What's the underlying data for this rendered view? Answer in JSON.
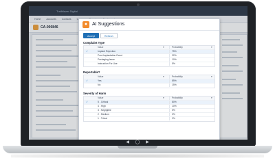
{
  "app": {
    "logo": "Trailblazer Digital",
    "nav": [
      "Home",
      "Accounts",
      "Contacts",
      "Cases",
      "Reports",
      "Dashboards"
    ],
    "record_title": "CA-000846"
  },
  "modal": {
    "title": "AI Suggestions",
    "accept_label": "Accept",
    "refresh_label": "Refresh",
    "column_value": "Value",
    "column_probability": "Probability",
    "sections": [
      {
        "title": "Complaint Type",
        "rows": [
          {
            "value": "Implant Rejection",
            "probability": "75%",
            "selected": true
          },
          {
            "value": "Post-Implantation Event",
            "probability": "22%",
            "selected": false
          },
          {
            "value": "Packaging Issue",
            "probability": "10%",
            "selected": false
          },
          {
            "value": "Instruction For Use",
            "probability": "5%",
            "selected": false
          }
        ]
      },
      {
        "title": "Reportable?",
        "rows": [
          {
            "value": "Yes",
            "probability": "85%",
            "selected": true
          },
          {
            "value": "No",
            "probability": "15%",
            "selected": false
          }
        ]
      },
      {
        "title": "Severity of Harm",
        "rows": [
          {
            "value": "5 - Critical",
            "probability": "80%",
            "selected": true
          },
          {
            "value": "4 - High",
            "probability": "10%",
            "selected": false
          },
          {
            "value": "3 - Negligible",
            "probability": "5%",
            "selected": false
          },
          {
            "value": "2 - Medium",
            "probability": "3%",
            "selected": false
          },
          {
            "value": "1 - Trivial",
            "probability": "2%",
            "selected": false
          }
        ]
      }
    ]
  },
  "colors": {
    "accent": "#1f6fb5",
    "ai_icon": "#f28b2c",
    "laptop_bezel": "#1f2226"
  },
  "icons": {
    "check": "checkmark-icon",
    "caret": "chevron-down-icon",
    "ai": "lightbulb-icon"
  }
}
